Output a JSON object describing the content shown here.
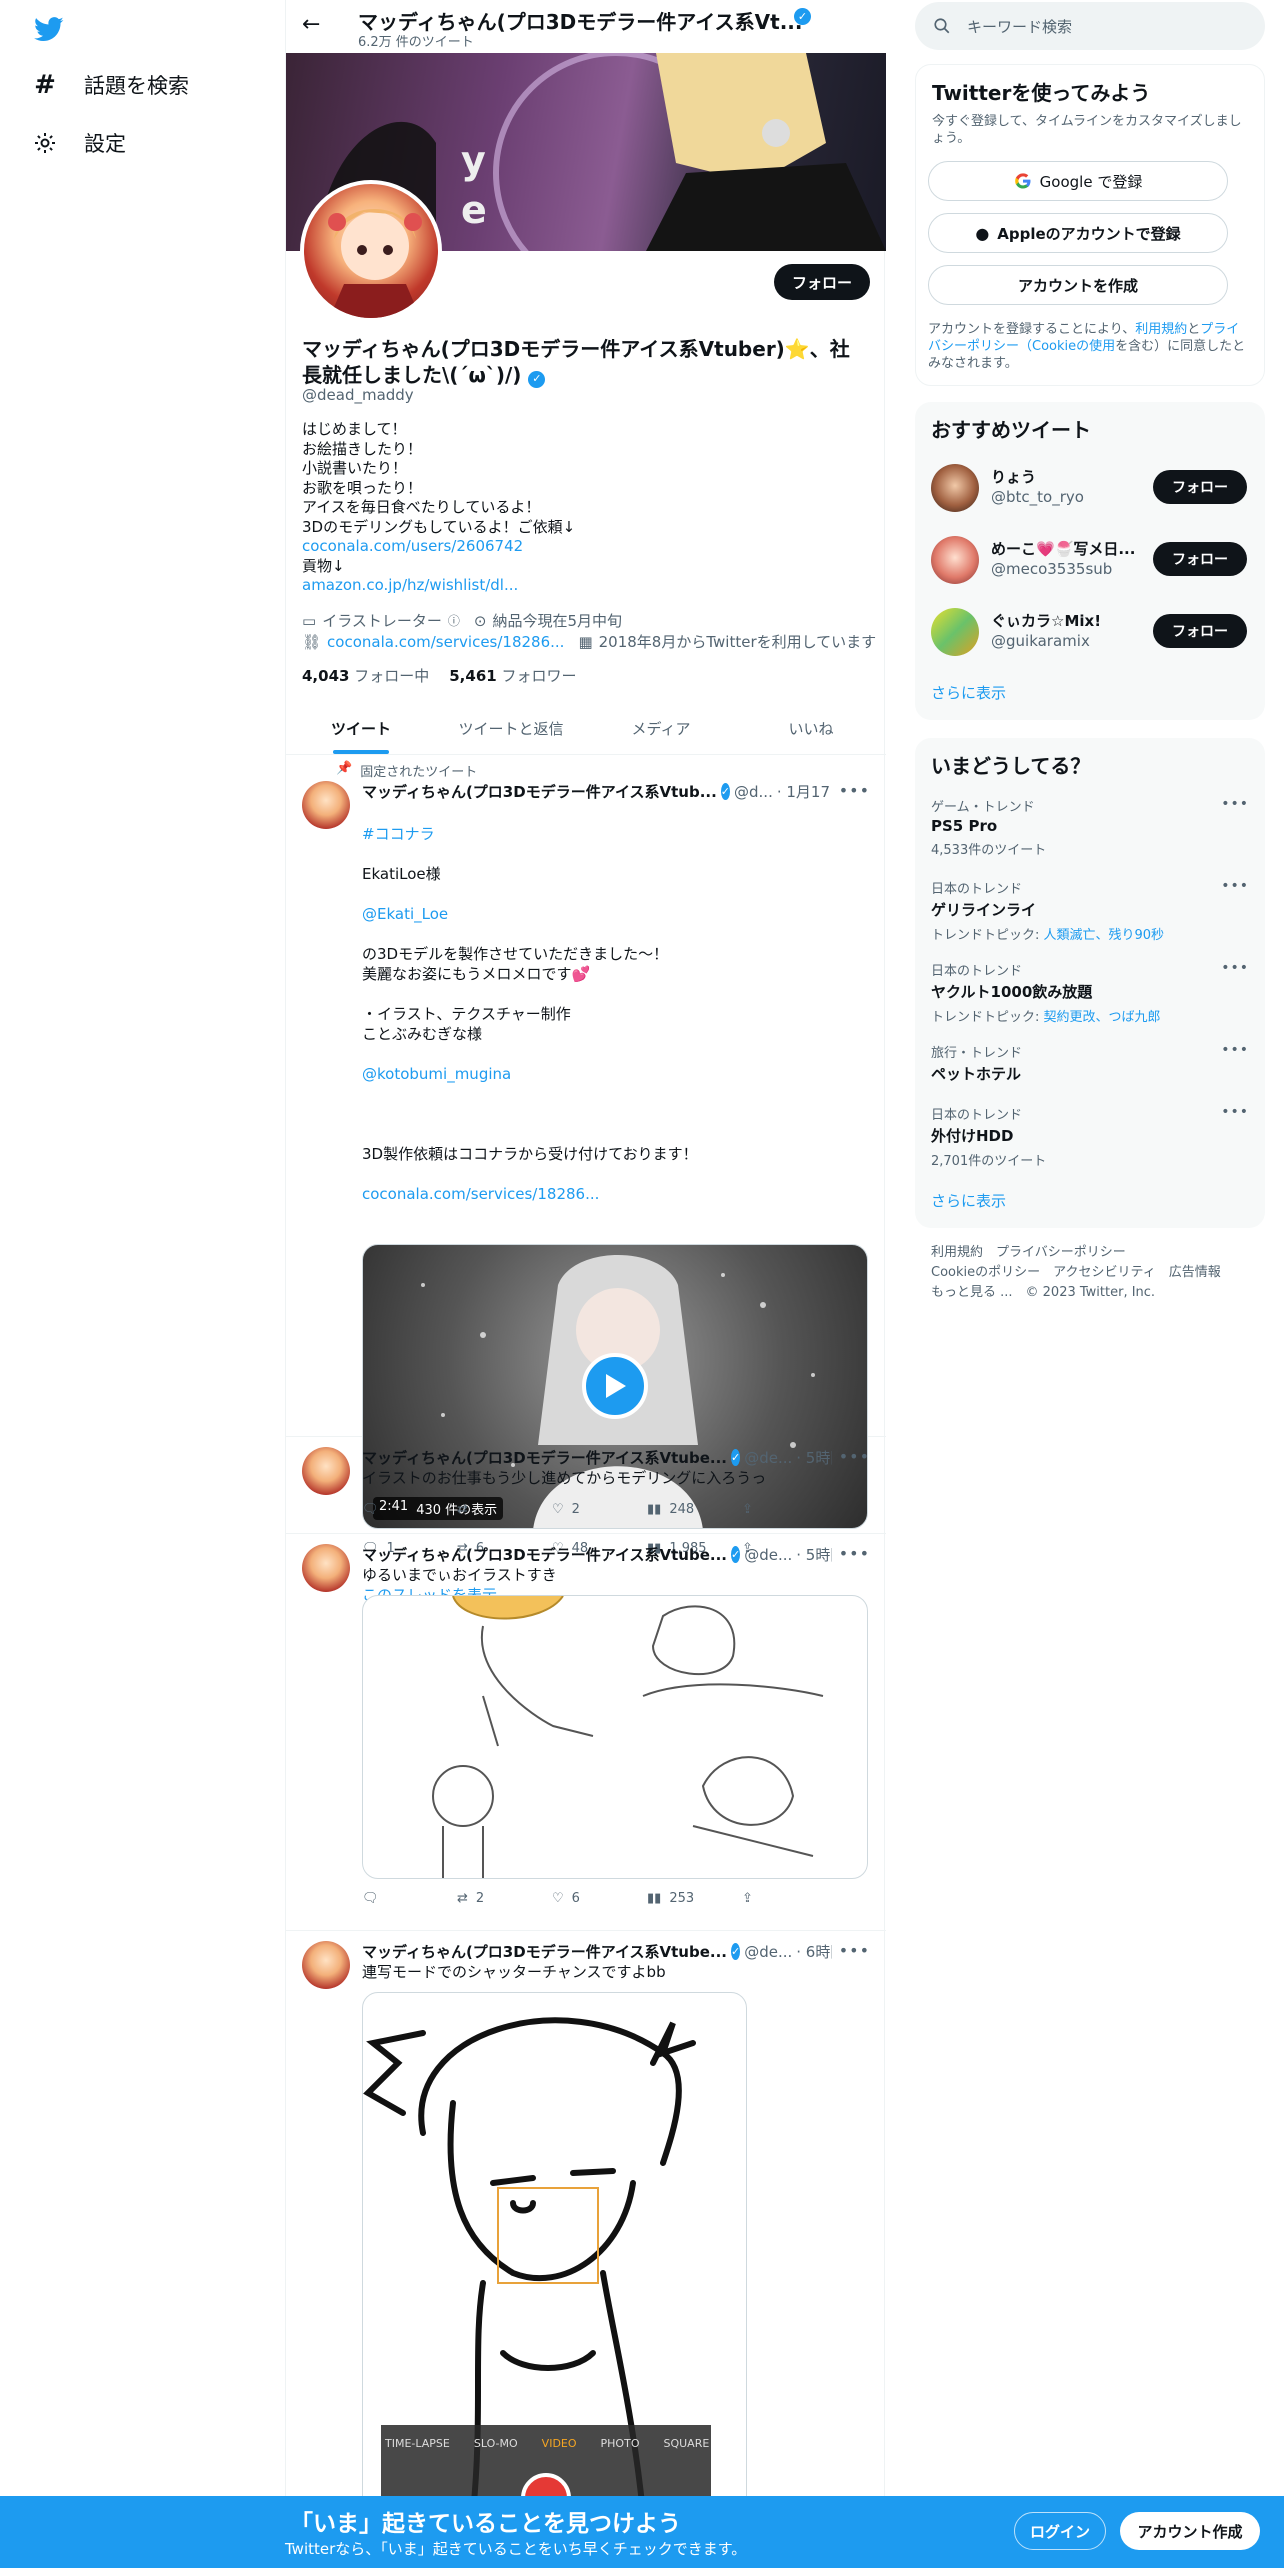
{
  "nav": {
    "items": [
      {
        "label": "話題を検索",
        "icon": "hashtag-icon"
      },
      {
        "label": "設定",
        "icon": "gear-icon"
      }
    ]
  },
  "header": {
    "name": "マッディちゃん(プロ3Dモデラー件アイス系Vt...",
    "tweet_count": "6.2万 件のツイート"
  },
  "profile": {
    "name": "マッディちゃん(プロ3Dモデラー件アイス系Vtuber)⭐、社長就任しました\\(´ω`)/)",
    "handle": "@dead_maddy",
    "follow_label": "フォロー",
    "bio_lines": [
      "はじめまして！",
      "お絵描きしたり！",
      "小説書いたり！",
      "お歌を唄ったり！",
      "アイスを毎日食べたりしているよ！",
      "3Dのモデリングもしているよ！ご依頼↓"
    ],
    "bio_link1": "coconala.com/users/2606742",
    "bio_text2": "貢物↓",
    "bio_link2": "amazon.co.jp/hz/wishlist/dl...",
    "category": "イラストレーター",
    "location": "納品今現在5月中旬",
    "website": "coconala.com/services/18286...",
    "joined": "2018年8月からTwitterを利用しています",
    "following_count": "4,043",
    "following_label": "フォロー中",
    "followers_count": "5,461",
    "followers_label": "フォロワー"
  },
  "tabs": [
    "ツイート",
    "ツイートと返信",
    "メディア",
    "いいね"
  ],
  "tweets": [
    {
      "pinned_label": "固定されたツイート",
      "name": "マッディちゃん(プロ3Dモデラー件アイス系Vtub...",
      "handle": "@d...",
      "time": "· 1月17日",
      "hashtag": "#ココナラ",
      "text1": "EkatiLoe様",
      "mention1": "@Ekati_Loe",
      "text2": "の3Dモデルを製作させていただきました～！\n 美麗なお姿にもうメロメロです💕\n\n・イラスト、テクスチャー制作\nことぶみむぎな様",
      "mention2": "@kotobumi_mugina",
      "text3": "3D製作依頼はココナラから受け付けております！",
      "link": "coconala.com/services/18286...",
      "video_duration": "2:41",
      "video_views": "430 件の表示",
      "replies": "1",
      "retweets": "6",
      "likes": "48",
      "views": "1,985",
      "thread_label": "このスレッドを表示"
    },
    {
      "name": "マッディちゃん(プロ3Dモデラー件アイス系Vtube...",
      "handle": "@de...",
      "time": "· 5時間",
      "text": "イラストのお仕事もう少し進めてからモデリングに入ろうっ",
      "replies": "",
      "retweets": "",
      "likes": "2",
      "views": "248"
    },
    {
      "name": "マッディちゃん(プロ3Dモデラー件アイス系Vtube...",
      "handle": "@de...",
      "time": "· 5時間",
      "text": "ゆるいまでぃおイラストすき",
      "replies": "",
      "retweets": "2",
      "likes": "6",
      "views": "253"
    },
    {
      "name": "マッディちゃん(プロ3Dモデラー件アイス系Vtube...",
      "handle": "@de...",
      "time": "· 6時間",
      "text": "連写モードでのシャッターチャンスですよbb",
      "camera_modes": [
        "TIME-LAPSE",
        "SLO-MO",
        "VIDEO",
        "PHOTO",
        "SQUARE"
      ]
    }
  ],
  "right": {
    "search_placeholder": "キーワード検索",
    "signup": {
      "title": "Twitterを使ってみよう",
      "subtitle": "今すぐ登録して、タイムラインをカスタマイズしましょう。",
      "google": "Google で登録",
      "apple": "Appleのアカウントで登録",
      "create": "アカウントを作成",
      "legal_pre": "アカウントを登録することにより、",
      "legal_terms": "利用規約",
      "legal_and": "と",
      "legal_privacy": "プライバシーポリシー（Cookieの使用",
      "legal_post": "を含む）に同意したとみなされます。"
    },
    "recommend": {
      "title": "おすすめツイート",
      "users": [
        {
          "name": "りょう",
          "handle": "@btc_to_ryo"
        },
        {
          "name": "めーこ💗🍧写メ日...",
          "handle": "@meco3535sub"
        },
        {
          "name": "ぐぃカラ☆Mix!",
          "handle": "@guikaramix"
        }
      ],
      "follow_label": "フォロー",
      "more": "さらに表示"
    },
    "trends": {
      "title": "いまどうしてる？",
      "items": [
        {
          "category": "ゲーム・トレンド",
          "title": "PS5 Pro",
          "sub": "4,533件のツイート"
        },
        {
          "category": "日本のトレンド",
          "title": "ゲリラインライ",
          "sub_label": "トレンドトピック: ",
          "sub_link": "人類滅亡、残り90秒"
        },
        {
          "category": "日本のトレンド",
          "title": "ヤクルト1000飲み放題",
          "sub_label": "トレンドトピック: ",
          "sub_link": "契約更改、つば九郎"
        },
        {
          "category": "旅行・トレンド",
          "title": "ペットホテル"
        },
        {
          "category": "日本のトレンド",
          "title": "外付けHDD",
          "sub": "2,701件のツイート"
        }
      ],
      "more": "さらに表示"
    },
    "footer": {
      "line1": "利用規約　プライバシーポリシー",
      "line2": "Cookieのポリシー　アクセシビリティ　広告情報",
      "line3": "もっと見る ...　© 2023 Twitter, Inc."
    }
  },
  "bottombar": {
    "title": "「いま」起きていることを見つけよう",
    "subtitle": "Twitterなら、「いま」起きていることをいち早くチェックできます。",
    "login": "ログイン",
    "signup": "アカウント作成"
  },
  "colors": {
    "accent": "#1d9bf0",
    "text": "#0f1419",
    "secondary": "#536471"
  }
}
